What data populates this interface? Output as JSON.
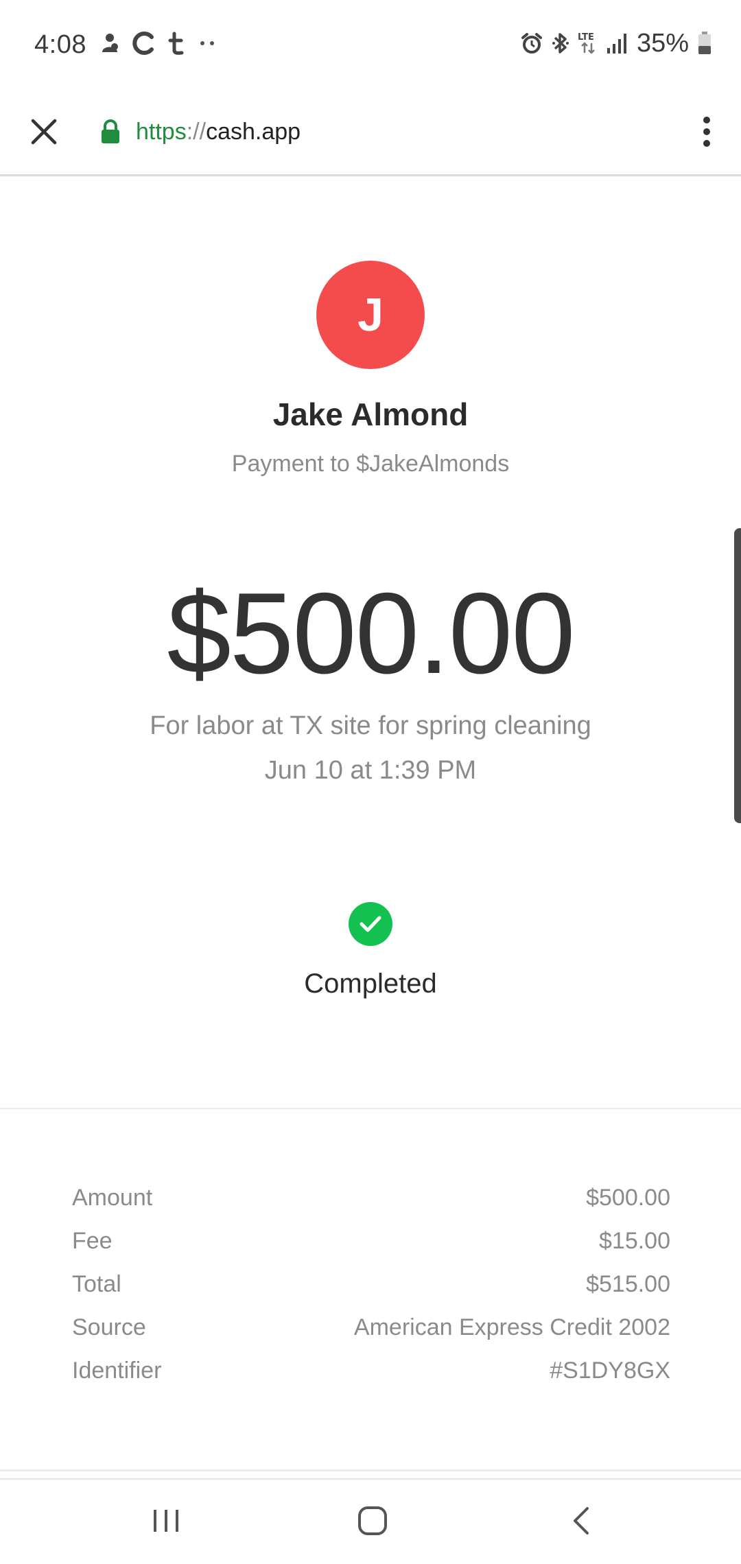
{
  "status_bar": {
    "time": "4:08",
    "left_icons": [
      "notification-icon",
      "c-app-icon",
      "tumblr-icon",
      "more-dots-icon"
    ],
    "right_icons": [
      "alarm-icon",
      "bluetooth-icon",
      "lte-icon",
      "signal-icon",
      "battery-icon"
    ],
    "battery_percent": "35%"
  },
  "browser": {
    "url_scheme": "https",
    "url_separator": "://",
    "url_host": "cash.app",
    "close_icon": "close-icon",
    "lock_icon": "lock-icon",
    "menu_icon": "more-vert-icon"
  },
  "payment": {
    "avatar_initial": "J",
    "recipient_name": "Jake Almond",
    "subtitle": "Payment to $JakeAlmonds",
    "amount": "$500.00",
    "note": "For labor at TX site for spring cleaning",
    "date": "Jun 10 at 1:39 PM",
    "status": "Completed"
  },
  "details": [
    {
      "label": "Amount",
      "value": "$500.00"
    },
    {
      "label": "Fee",
      "value": "$15.00"
    },
    {
      "label": "Total",
      "value": "$515.00"
    },
    {
      "label": "Source",
      "value": "American Express Credit 2002"
    },
    {
      "label": "Identifier",
      "value": "#S1DY8GX"
    }
  ],
  "nav_bar": {
    "recents_icon": "recents-icon",
    "home_icon": "home-icon",
    "back_icon": "back-icon"
  },
  "colors": {
    "avatar_bg": "#f44c4d",
    "success_green": "#12c150",
    "secure_green": "#1e8e3e"
  }
}
